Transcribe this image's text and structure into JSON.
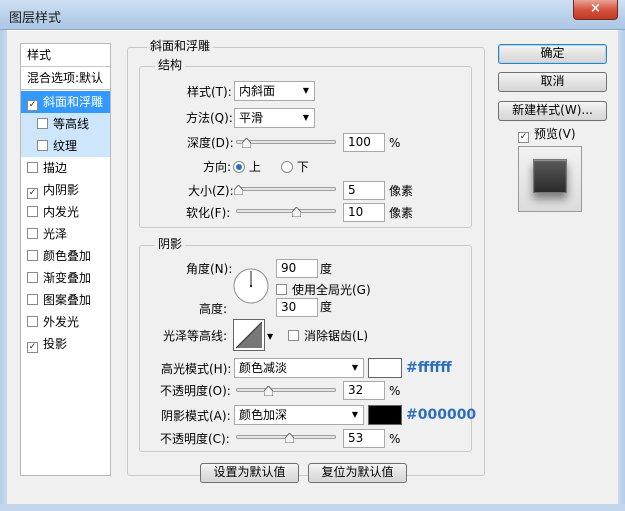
{
  "window": {
    "title": "图层样式",
    "close": "×"
  },
  "sidebar": {
    "header": "样式",
    "blend": "混合选项:默认",
    "items": [
      {
        "label": "斜面和浮雕",
        "checked": true
      },
      {
        "label": "等高线",
        "checked": false
      },
      {
        "label": "纹理",
        "checked": false
      },
      {
        "label": "描边",
        "checked": false
      },
      {
        "label": "内阴影",
        "checked": true
      },
      {
        "label": "内发光",
        "checked": false
      },
      {
        "label": "光泽",
        "checked": false
      },
      {
        "label": "颜色叠加",
        "checked": false
      },
      {
        "label": "渐变叠加",
        "checked": false
      },
      {
        "label": "图案叠加",
        "checked": false
      },
      {
        "label": "外发光",
        "checked": false
      },
      {
        "label": "投影",
        "checked": true
      }
    ]
  },
  "bevel": {
    "title": "斜面和浮雕",
    "structure": {
      "title": "结构",
      "style_label": "样式(T):",
      "style_value": "内斜面",
      "method_label": "方法(Q):",
      "method_value": "平滑",
      "depth_label": "深度(D):",
      "depth_value": "100",
      "depth_unit": "%",
      "depth_level": 0.1,
      "direction_label": "方向:",
      "dir_up": "上",
      "dir_down": "下",
      "size_label": "大小(Z):",
      "size_value": "5",
      "size_unit": "像素",
      "size_level": 0.02,
      "soften_label": "软化(F):",
      "soften_value": "10",
      "soften_unit": "像素",
      "soften_level": 0.6
    },
    "shading": {
      "title": "阴影",
      "angle_label": "角度(N):",
      "angle_value": "90",
      "angle_unit": "度",
      "global_light": "使用全局光(G)",
      "altitude_label": "高度:",
      "altitude_value": "30",
      "altitude_unit": "度",
      "gloss_label": "光泽等高线:",
      "anti_alias": "消除锯齿(L)",
      "highlight_label": "高光模式(H):",
      "highlight_mode": "颜色减淡",
      "highlight_color": "#ffffff",
      "highlight_hex": "#ffffff",
      "hl_opacity_label": "不透明度(O):",
      "hl_opacity_value": "32",
      "hl_opacity_unit": "%",
      "hl_opacity_level": 0.32,
      "shadow_label": "阴影模式(A):",
      "shadow_mode": "颜色加深",
      "shadow_color": "#000000",
      "shadow_hex": "#000000",
      "sh_opacity_label": "不透明度(C):",
      "sh_opacity_value": "53",
      "sh_opacity_unit": "%",
      "sh_opacity_level": 0.53
    },
    "make_default": "设置为默认值",
    "reset_default": "复位为默认值"
  },
  "buttons": {
    "ok": "确定",
    "cancel": "取消",
    "new_style": "新建样式(W)...",
    "preview": "预览(V)"
  }
}
